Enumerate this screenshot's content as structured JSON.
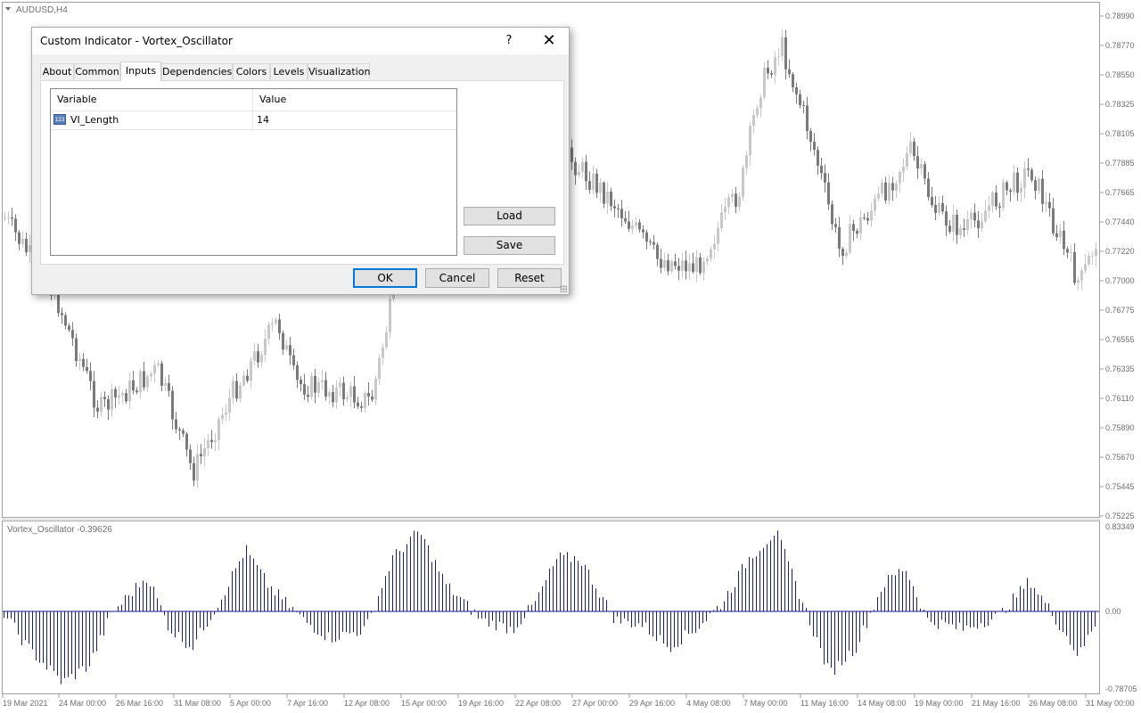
{
  "chart": {
    "symbol_label": "AUDUSD,H4",
    "price_ticks": [
      "0.78990",
      "0.78770",
      "0.78550",
      "0.78325",
      "0.78105",
      "0.77885",
      "0.77665",
      "0.77440",
      "0.77220",
      "0.77000",
      "0.76775",
      "0.76555",
      "0.76335",
      "0.76110",
      "0.75890",
      "0.75670",
      "0.75445",
      "0.75225"
    ],
    "indicator_label": "Vortex_Oscillator -0.39626",
    "indicator_ticks": [
      "0.83349",
      "0.00",
      "-0.78705"
    ],
    "time_labels": [
      "19 Mar 2021",
      "24 Mar 00:00",
      "26 Mar 16:00",
      "31 Mar 08:00",
      "5 Apr 00:00",
      "7 Apr 16:00",
      "12 Apr 08:00",
      "15 Apr 00:00",
      "19 Apr 16:00",
      "22 Apr 08:00",
      "27 Apr 00:00",
      "29 Apr 16:00",
      "4 May 08:00",
      "7 May 00:00",
      "11 May 16:00",
      "14 May 08:00",
      "19 May 00:00",
      "21 May 16:00",
      "26 May 08:00",
      "31 May 00:00"
    ],
    "colors": {
      "bull": "#c8c8c8",
      "bear": "#7a7a7a",
      "histogram": "#1a1a8c",
      "grid_text": "#6e6e6e"
    }
  },
  "dialog": {
    "title": "Custom Indicator - Vortex_Oscillator",
    "help_label": "?",
    "close_label": "✕",
    "tabs": [
      "About",
      "Common",
      "Inputs",
      "Dependencies",
      "Colors",
      "Levels",
      "Visualization"
    ],
    "active_tab": "Inputs",
    "grid_headers": {
      "variable": "Variable",
      "value": "Value"
    },
    "inputs": [
      {
        "icon": "123-icon",
        "icon_text": "123",
        "variable": "VI_Length",
        "value": "14"
      }
    ],
    "buttons": {
      "load": "Load",
      "save": "Save",
      "ok": "OK",
      "cancel": "Cancel",
      "reset": "Reset"
    }
  }
}
